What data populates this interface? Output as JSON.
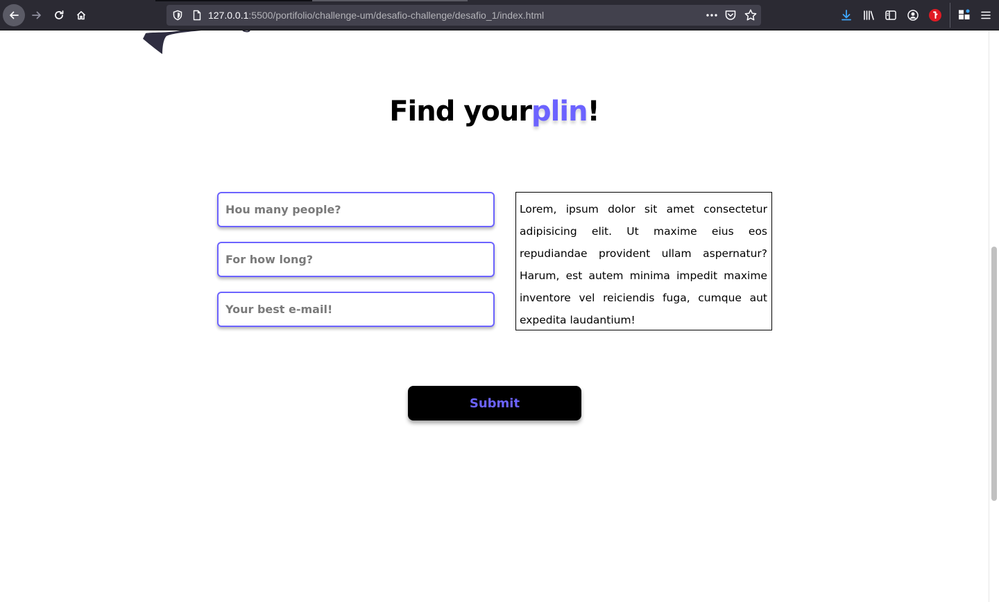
{
  "browser": {
    "url_host": "127.0.0.1",
    "url_rest": ":5500/portifolio/challenge-um/desafio-challenge/desafio_1/index.html",
    "icons": [
      "back-icon",
      "forward-icon",
      "reload-icon",
      "home-icon",
      "shield-icon",
      "page-icon",
      "more-icon",
      "pocket-icon",
      "star-icon",
      "download-icon",
      "library-icon",
      "sidebar-icon",
      "account-icon",
      "extension-icon",
      "puzzle-icon",
      "menu-icon"
    ]
  },
  "page": {
    "heading": {
      "prefix": "Find your",
      "accent": "plin",
      "suffix": "!"
    },
    "form": {
      "people_placeholder": "Hou many people?",
      "duration_placeholder": "For how long?",
      "email_placeholder": "Your best e-mail!",
      "description": "Lorem, ipsum dolor sit amet consectetur adipisicing elit. Ut maxime eius eos repudiandae provident ullam aspernatur? Harum, est autem minima impedit maxime inventore vel reiciendis fuga, cumque aut expedita laudantium!",
      "submit_label": "Submit"
    }
  },
  "colors": {
    "accent": "#6c63ff",
    "toolbar_bg": "#2b2a33",
    "urlbar_bg": "#42414d",
    "button_bg": "#000000"
  }
}
